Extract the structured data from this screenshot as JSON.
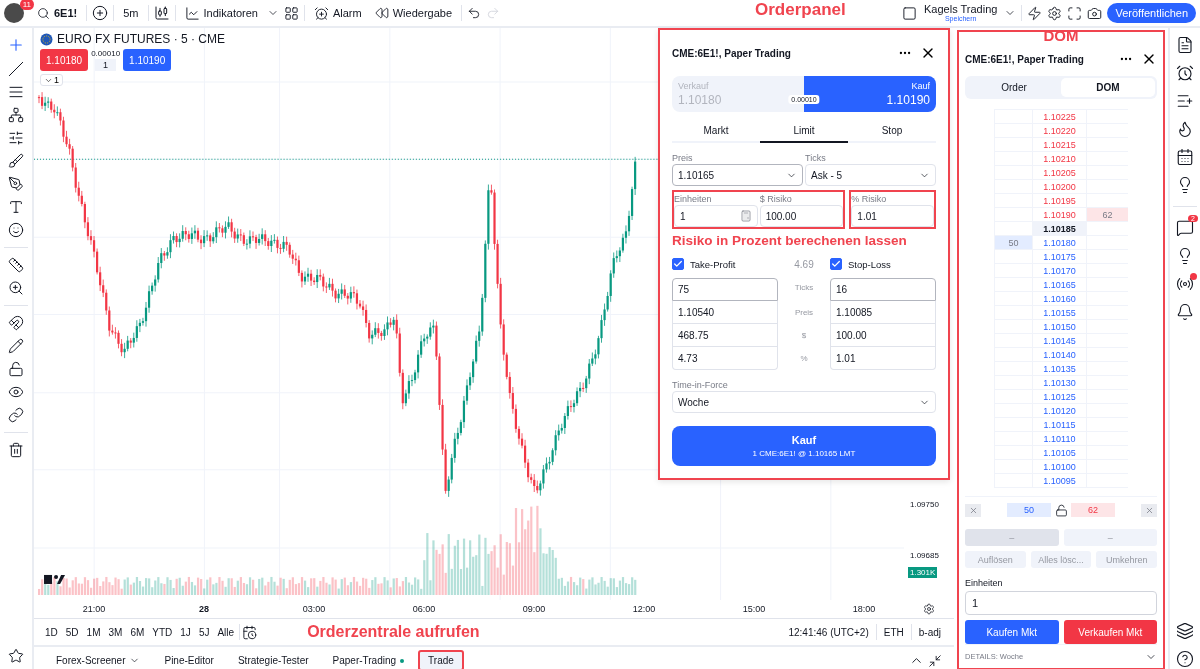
{
  "top_bar": {
    "notification_count": "11",
    "symbol": "6E1!",
    "interval": "5m",
    "indicators": "Indikatoren",
    "alert": "Alarm",
    "replay": "Wiedergabe",
    "redo_disabled": true,
    "account": {
      "name": "Kagels Trading",
      "status": "Speichern"
    },
    "publish": "Veröffentlichen"
  },
  "annotations": {
    "order_panel": "Orderpanel",
    "order_center": "Orderzentrale aufrufen"
  },
  "chart": {
    "title": "EURO FX FUTURES · 5 · CME",
    "sell_price": "1.10180",
    "spread": "0.00010",
    "quantity": "1",
    "buy_price": "1.10190",
    "legend_toggle": "1",
    "price_labels": [
      {
        "label": "1.09750",
        "kind": "plain"
      },
      {
        "label": "1.09685",
        "kind": "plain"
      },
      {
        "label": "1.301K",
        "kind": "volume"
      }
    ],
    "time_labels": [
      {
        "label": "21:00",
        "bold": false
      },
      {
        "label": "28",
        "bold": true
      },
      {
        "label": "03:00",
        "bold": false
      },
      {
        "label": "06:00",
        "bold": false
      },
      {
        "label": "09:00",
        "bold": false
      },
      {
        "label": "12:00",
        "bold": false
      },
      {
        "label": "15:00",
        "bold": false
      },
      {
        "label": "18:00",
        "bold": false
      }
    ]
  },
  "range_bar": {
    "ranges": [
      "1D",
      "5D",
      "1M",
      "3M",
      "6M",
      "YTD",
      "1J",
      "5J",
      "Alle"
    ],
    "clock": "12:41:46 (UTC+2)",
    "session": "ETH",
    "adjustment": "b-adj"
  },
  "bottom_tabs": [
    {
      "label": "Forex-Screener",
      "kind": "dropdown",
      "selected": false,
      "highlighted": false
    },
    {
      "label": "Pine-Editor",
      "kind": "plain",
      "selected": false,
      "highlighted": false
    },
    {
      "label": "Strategie-Tester",
      "kind": "plain",
      "selected": false,
      "highlighted": false
    },
    {
      "label": "Paper-Trading",
      "kind": "connected",
      "selected": false,
      "highlighted": false
    },
    {
      "label": "Trade",
      "kind": "plain",
      "selected": true,
      "highlighted": true
    }
  ],
  "order_panel": {
    "title": "CME:6E1!, Paper Trading",
    "highlighted": true,
    "sides": [
      {
        "label": "Verkauf",
        "price": "1.10180",
        "kind": "sell",
        "selected": false
      },
      {
        "label": "Kauf",
        "price": "1.10190",
        "kind": "buy",
        "selected": true
      }
    ],
    "spread": "0.00010",
    "order_types": [
      {
        "label": "Markt",
        "selected": false
      },
      {
        "label": "Limit",
        "selected": true
      },
      {
        "label": "Stop",
        "selected": false
      }
    ],
    "price": {
      "label": "Preis",
      "value": "1.10165"
    },
    "ticks": {
      "label": "Ticks",
      "value": "Ask - 5"
    },
    "risk_group": {
      "highlighted": true,
      "units": {
        "label": "Einheiten",
        "value": "1"
      },
      "dollar_risk": {
        "label": "$ Risiko",
        "value": "100.00"
      }
    },
    "percent_risk": {
      "label": "% Risiko",
      "value": "1.01",
      "highlighted": true
    },
    "annotation": "Risiko in Prozent berechenen lassen",
    "take_profit": {
      "label": "Take-Profit",
      "checked": true,
      "values": [
        "75",
        "1.10540",
        "468.75",
        "4.73"
      ]
    },
    "ratio": "4.69",
    "row_labels": [
      "Ticks",
      "Preis",
      "$",
      "%"
    ],
    "stop_loss": {
      "label": "Stop-Loss",
      "checked": true,
      "values": [
        "16",
        "1.10085",
        "100.00",
        "1.01"
      ]
    },
    "time_in_force": {
      "label": "Time-in-Force",
      "value": "Woche"
    },
    "submit": {
      "label": "Kauf",
      "detail": "1 CME:6E1! @ 1.10165 LMT"
    }
  },
  "dom": {
    "title": "CME:6E1!, Paper Trading",
    "highlighted": true,
    "annotation": "DOM",
    "tabs": [
      {
        "label": "Order",
        "selected": false
      },
      {
        "label": "DOM",
        "selected": true
      }
    ],
    "ladder": [
      {
        "price": "1.10225",
        "kind": "ask"
      },
      {
        "price": "1.10220",
        "kind": "ask"
      },
      {
        "price": "1.10215",
        "kind": "ask"
      },
      {
        "price": "1.10210",
        "kind": "ask"
      },
      {
        "price": "1.10205",
        "kind": "ask"
      },
      {
        "price": "1.10200",
        "kind": "ask"
      },
      {
        "price": "1.10195",
        "kind": "ask"
      },
      {
        "price": "1.10190",
        "kind": "ask",
        "ask_size": "62"
      },
      {
        "price": "1.10185",
        "kind": "mid"
      },
      {
        "price": "1.10180",
        "kind": "bid",
        "bid_size": "50"
      },
      {
        "price": "1.10175",
        "kind": "bid"
      },
      {
        "price": "1.10170",
        "kind": "bid"
      },
      {
        "price": "1.10165",
        "kind": "bid"
      },
      {
        "price": "1.10160",
        "kind": "bid"
      },
      {
        "price": "1.10155",
        "kind": "bid"
      },
      {
        "price": "1.10150",
        "kind": "bid"
      },
      {
        "price": "1.10145",
        "kind": "bid"
      },
      {
        "price": "1.10140",
        "kind": "bid"
      },
      {
        "price": "1.10135",
        "kind": "bid"
      },
      {
        "price": "1.10130",
        "kind": "bid"
      },
      {
        "price": "1.10125",
        "kind": "bid"
      },
      {
        "price": "1.10120",
        "kind": "bid"
      },
      {
        "price": "1.10115",
        "kind": "bid"
      },
      {
        "price": "1.10110",
        "kind": "bid"
      },
      {
        "price": "1.10105",
        "kind": "bid"
      },
      {
        "price": "1.10100",
        "kind": "bid"
      },
      {
        "price": "1.10095",
        "kind": "bid"
      }
    ],
    "totals": {
      "bid": "50",
      "ask": "62"
    },
    "action_buttons": [
      {
        "label": "–",
        "disabled": true
      },
      {
        "label": "–",
        "disabled": true
      }
    ],
    "secondary_buttons": [
      {
        "label": "Auflösen",
        "disabled": true
      },
      {
        "label": "Alles lösc...",
        "disabled": true
      },
      {
        "label": "Umkehren",
        "disabled": true
      }
    ],
    "units": {
      "label": "Einheiten",
      "value": "1"
    },
    "buy_button": "Kaufen Mkt",
    "sell_button": "Verkaufen Mkt",
    "details": "DETAILS: Woche"
  },
  "right_sidebar": {
    "chat_badge": "2",
    "broadcast_dot": true
  }
}
